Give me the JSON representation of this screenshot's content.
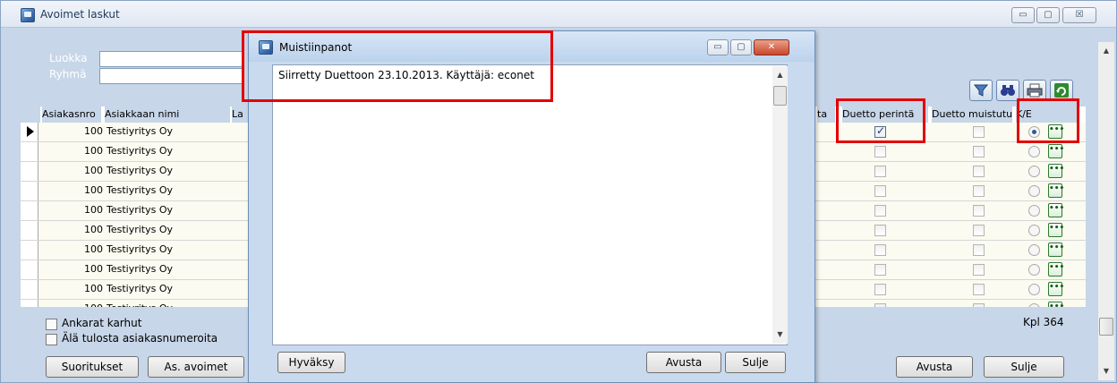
{
  "main": {
    "title": "Avoimet laskut",
    "window_buttons": {
      "minimize": "▭",
      "maximize": "▢",
      "close": "☒"
    },
    "filters": {
      "luokka_label": "Luokka",
      "ryhma_label": "Ryhmä",
      "luokka_value": "",
      "ryhma_value": ""
    },
    "toolbar": [
      "filter-icon",
      "binoculars-icon",
      "print-icon",
      "refresh-icon"
    ],
    "grid": {
      "headers": {
        "asiakasnro": "Asiakasnro",
        "nimi": "Asiakkaan nimi",
        "la": "La",
        "ta": "ta",
        "duetto_perinta": "Duetto perintä",
        "duetto_muistutus": "Duetto muistutus",
        "ke": "K/E"
      },
      "rows": [
        {
          "nro": "100",
          "nimi": "Testiyritys Oy",
          "perinta": true,
          "ke": true
        },
        {
          "nro": "100",
          "nimi": "Testiyritys Oy",
          "perinta": false,
          "ke": false
        },
        {
          "nro": "100",
          "nimi": "Testiyritys Oy",
          "perinta": false,
          "ke": false
        },
        {
          "nro": "100",
          "nimi": "Testiyritys Oy",
          "perinta": false,
          "ke": false
        },
        {
          "nro": "100",
          "nimi": "Testiyritys Oy",
          "perinta": false,
          "ke": false
        },
        {
          "nro": "100",
          "nimi": "Testiyritys Oy",
          "perinta": false,
          "ke": false
        },
        {
          "nro": "100",
          "nimi": "Testiyritys Oy",
          "perinta": false,
          "ke": false
        },
        {
          "nro": "100",
          "nimi": "Testiyritys Oy",
          "perinta": false,
          "ke": false
        },
        {
          "nro": "100",
          "nimi": "Testiyritys Oy",
          "perinta": false,
          "ke": false
        },
        {
          "nro": "100",
          "nimi": "Testiyritys Oy",
          "perinta": false,
          "ke": false
        }
      ]
    },
    "options": {
      "ankarat_karhut": "Ankarat karhut",
      "ala_tulosta": "Älä tulosta asiakasnumeroita"
    },
    "buttons": {
      "suoritukset": "Suoritukset",
      "as_avoimet": "As. avoimet",
      "avusta": "Avusta",
      "sulje": "Sulje"
    },
    "kpl": "Kpl 364"
  },
  "dialog": {
    "title": "Muistiinpanot",
    "note_text": "Siirretty Duettoon 23.10.2013. Käyttäjä: econet",
    "buttons": {
      "hyvaksy": "Hyväksy",
      "avusta": "Avusta",
      "sulje": "Sulje"
    }
  },
  "colors": {
    "highlight": "#e30000",
    "window_bg": "#c7d6e8",
    "row_bg": "#fbfbf1"
  }
}
